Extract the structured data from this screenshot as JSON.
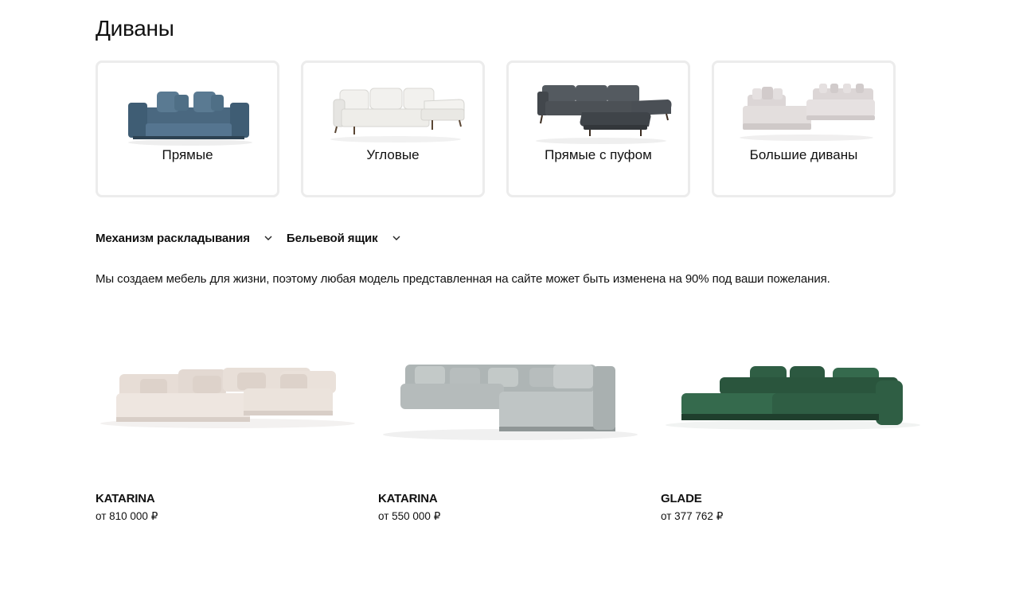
{
  "page": {
    "title": "Диваны"
  },
  "categories": [
    {
      "label": "Прямые",
      "icon": "straight-sofa-image"
    },
    {
      "label": "Угловые",
      "icon": "corner-sofa-image"
    },
    {
      "label": "Прямые с пуфом",
      "icon": "sofa-with-pouf-image"
    },
    {
      "label": "Большие диваны",
      "icon": "large-sofa-image"
    }
  ],
  "filters": [
    {
      "label": "Механизм раскладывания"
    },
    {
      "label": "Бельевой ящик"
    }
  ],
  "note": "Мы создаем мебель для жизни, поэтому любая модель представленная на сайте может быть изменена на 90% под ваши пожелания.",
  "products": [
    {
      "name": "KATARINA",
      "price": "от 810 000 ₽",
      "color": "#ebe3dc"
    },
    {
      "name": "KATARINA",
      "price": "от 550 000 ₽",
      "color": "#b9bfbf"
    },
    {
      "name": "GLADE",
      "price": "от 377 762 ₽",
      "color": "#2f5e44"
    }
  ],
  "colors": {
    "straight_sofa": "#4f6f86",
    "corner_sofa": "#ecebe8",
    "pouf_sofa": "#4a4e53",
    "large_sofa": "#d8d2d2",
    "card_border": "#ececec"
  }
}
